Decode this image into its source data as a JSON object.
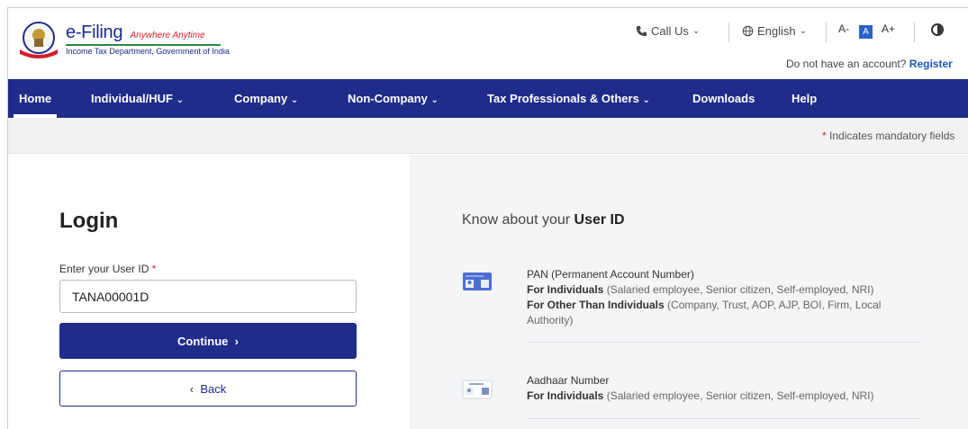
{
  "header": {
    "logo_title": "e-Filing",
    "logo_tagline": "Anywhere Anytime",
    "logo_subtitle": "Income Tax Department, Government of India",
    "call_us": "Call Us",
    "language": "English",
    "font_decrease": "A-",
    "font_normal": "A",
    "font_increase": "A+",
    "no_account_text": "Do not have an account?",
    "register_link": "Register"
  },
  "nav": {
    "items": [
      {
        "label": "Home"
      },
      {
        "label": "Individual/HUF"
      },
      {
        "label": "Company"
      },
      {
        "label": "Non-Company"
      },
      {
        "label": "Tax Professionals & Others"
      },
      {
        "label": "Downloads"
      },
      {
        "label": "Help"
      }
    ]
  },
  "notice": {
    "mandatory_star": "*",
    "mandatory_text": "Indicates mandatory fields"
  },
  "login": {
    "title": "Login",
    "field_label": "Enter your User ID",
    "required_mark": "*",
    "user_id_value": "TANA00001D",
    "continue_label": "Continue",
    "back_label": "Back"
  },
  "info": {
    "title_prefix": "Know about your",
    "title_bold": "User ID",
    "items": [
      {
        "name": "PAN (Permanent Account Number)",
        "line1_bold": "For Individuals",
        "line1_rest": "(Salaried employee, Senior citizen, Self-employed, NRI)",
        "line2_bold": "For Other Than Individuals",
        "line2_rest": "(Company, Trust, AOP, AJP, BOI, Firm, Local Authority)"
      },
      {
        "name": "Aadhaar Number",
        "line1_bold": "For Individuals",
        "line1_rest": "(Salaried employee, Senior citizen, Self-employed, NRI)"
      }
    ]
  },
  "colors": {
    "brand_navy": "#1f2c8a",
    "link_blue": "#1c58c2",
    "required_red": "#d21f2b"
  }
}
